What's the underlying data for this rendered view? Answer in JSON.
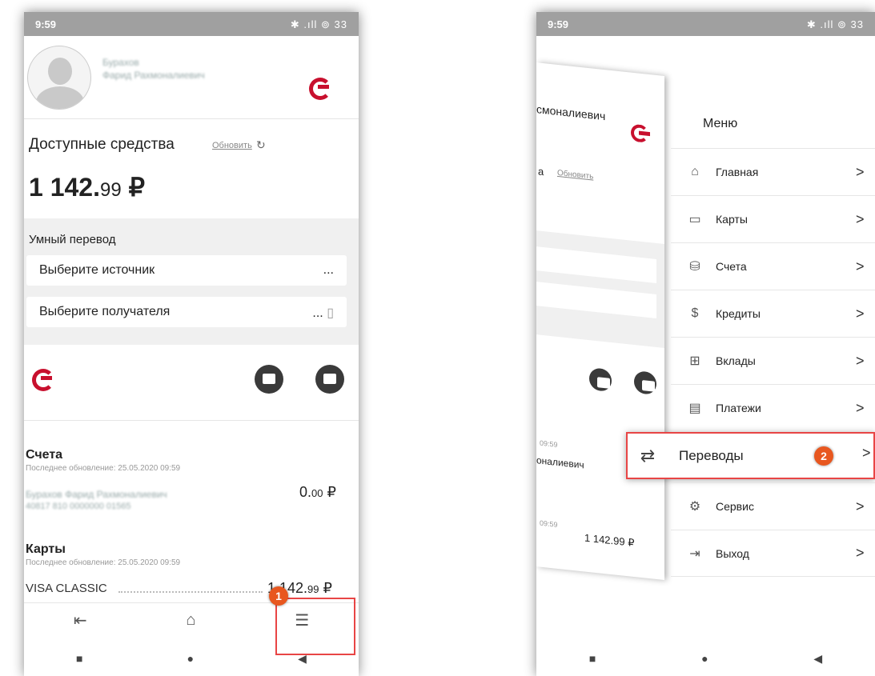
{
  "left": {
    "status": {
      "time": "9:59",
      "icons": "✱ .ıll ⊚ 33"
    },
    "profile": {
      "name_line1": "Бурахов",
      "name_line2": "Фарид Рахмоналиевич"
    },
    "funds": {
      "label": "Доступные средства",
      "refresh": "Обновить",
      "amount_int": "1 142.",
      "amount_dec": "99",
      "currency": "₽"
    },
    "transfer": {
      "title": "Умный перевод",
      "source": "Выберите источник",
      "source_more": "...",
      "recipient": "Выберите получателя",
      "recipient_more": "..."
    },
    "accounts": {
      "title": "Счета",
      "updated": "Последнее обновление: 25.05.2020 09:59",
      "owner": "Бурахов Фарид Рахмоналиевич",
      "amount": "0.",
      "amount_dec": "00",
      "currency": "₽",
      "number": "40817 810 0000000 01565"
    },
    "cards": {
      "title": "Карты",
      "updated": "Последнее обновление: 25.05.2020 09:59",
      "card_name": "VISA CLASSIC",
      "amount": "1 142.",
      "amount_dec": "99",
      "currency": "₽"
    },
    "badge": "1"
  },
  "right": {
    "status": {
      "time": "9:59",
      "icons": "✱ .ıll ⊚ 33"
    },
    "behind": {
      "name": "смоналиевич",
      "funds": "а",
      "refresh": "Обновить",
      "time1": "09:59",
      "name2": "оналиевич",
      "time2": "09:59",
      "amount": "1 142.99 ₽"
    },
    "menu": {
      "title": "Меню",
      "items": [
        {
          "label": "Главная",
          "icon": "home-icon",
          "glyph": "⌂"
        },
        {
          "label": "Карты",
          "icon": "card-icon",
          "glyph": "▭"
        },
        {
          "label": "Счета",
          "icon": "coins-icon",
          "glyph": "⛁"
        },
        {
          "label": "Кредиты",
          "icon": "loan-icon",
          "glyph": "$"
        },
        {
          "label": "Вклады",
          "icon": "deposit-icon",
          "glyph": "⊞"
        },
        {
          "label": "Платежи",
          "icon": "document-icon",
          "glyph": "▤"
        },
        {
          "label": "Переводы",
          "icon": "transfer-icon",
          "glyph": "⇄"
        },
        {
          "label": "Сервис",
          "icon": "settings-icon",
          "glyph": "⚙"
        },
        {
          "label": "Выход",
          "icon": "logout-icon",
          "glyph": "⇥"
        }
      ],
      "chevron": ">"
    },
    "badge": "2"
  },
  "icons": {
    "logout": "⇤",
    "home": "⌂",
    "menu": "☰",
    "stop": "■",
    "circle": "●",
    "back": "◀",
    "refresh": "↻",
    "phonebook": "▯"
  }
}
